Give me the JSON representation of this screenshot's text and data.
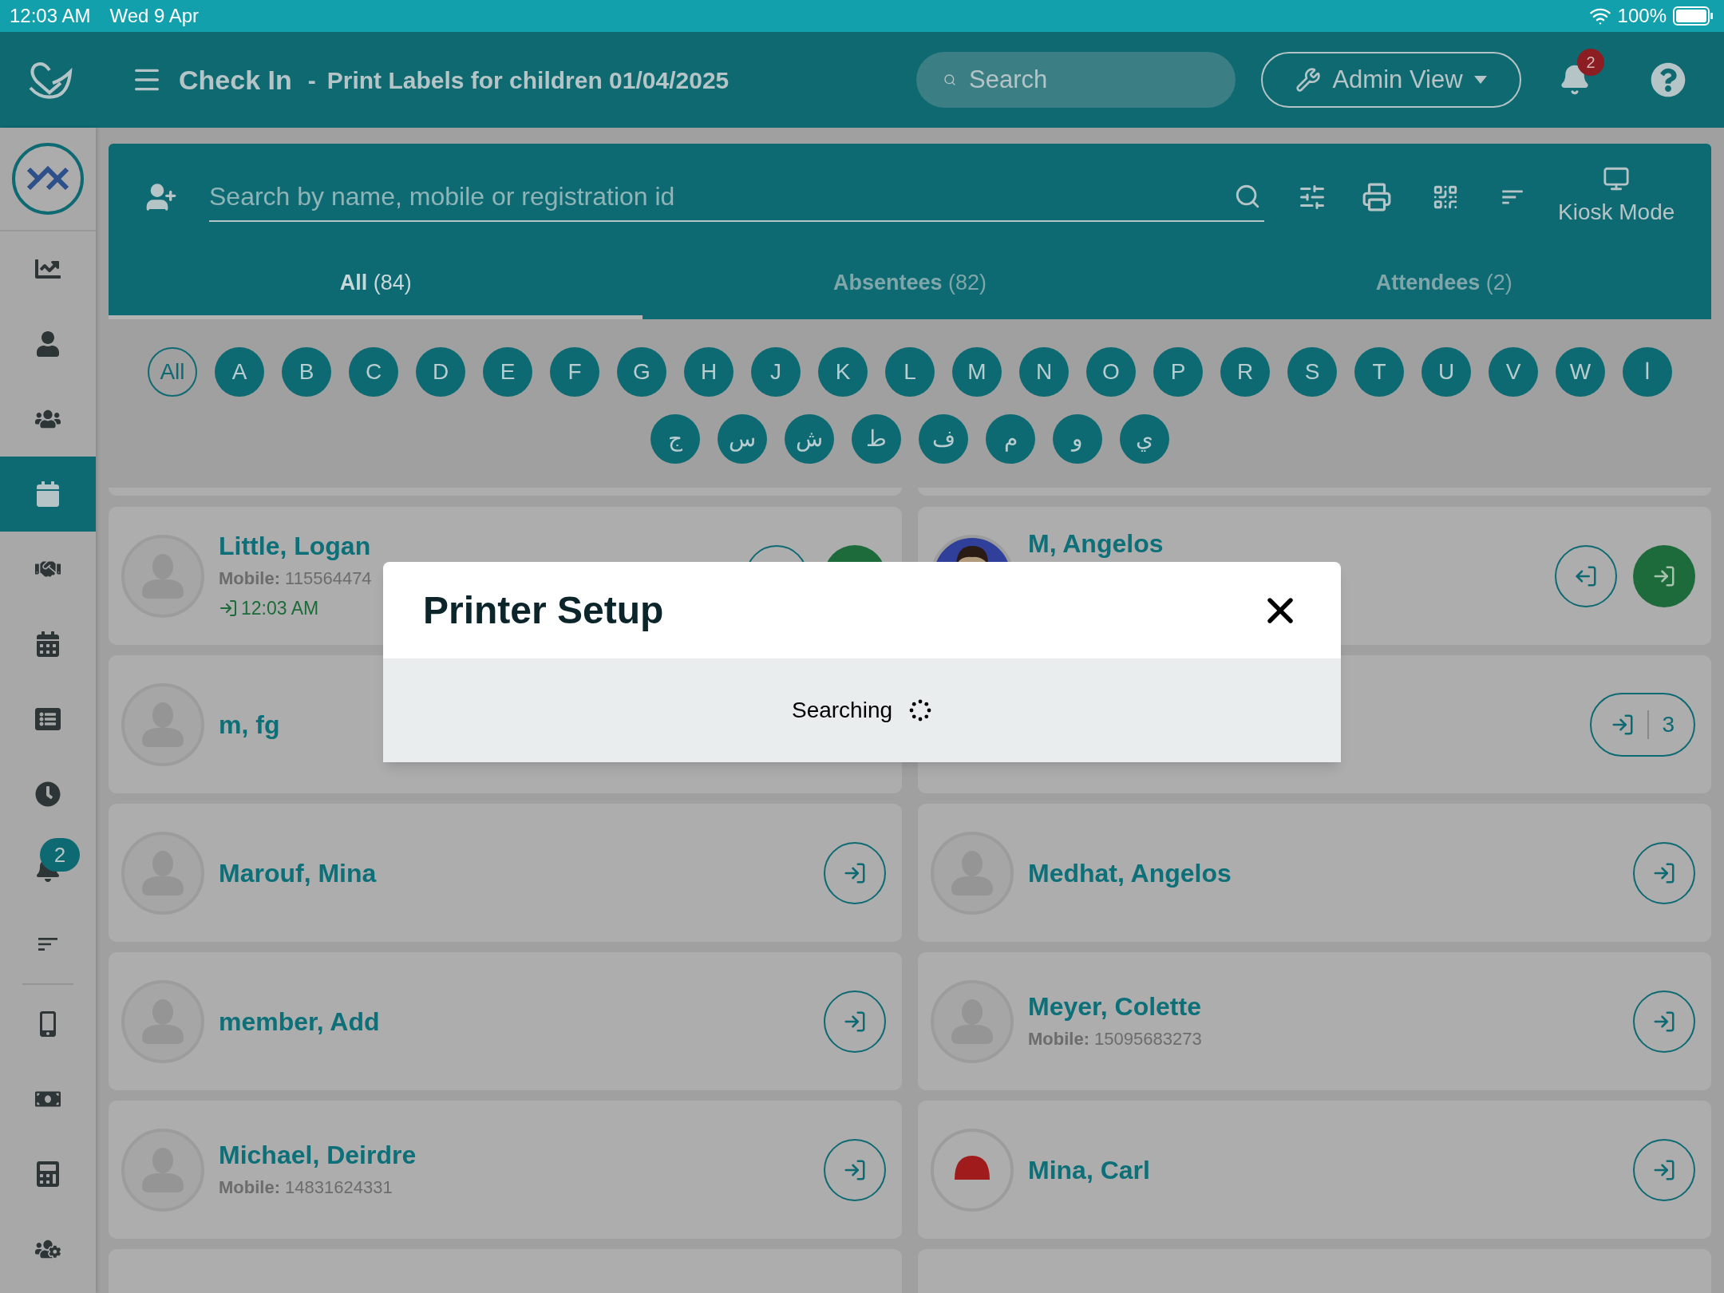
{
  "status_bar": {
    "time": "12:03 AM",
    "date": "Wed 9 Apr",
    "battery": "100%"
  },
  "header": {
    "title": "Check In",
    "separator": "-",
    "subtitle": "Print Labels for children 01/04/2025",
    "search_placeholder": "Search",
    "admin_button": "Admin View",
    "notification_badge": "2"
  },
  "sidebar": {
    "items": [
      {
        "selected": false
      },
      {
        "selected": false
      },
      {
        "selected": false
      },
      {
        "selected": true
      },
      {
        "selected": false
      },
      {
        "selected": false
      },
      {
        "selected": false
      },
      {
        "selected": false
      },
      {
        "selected": false,
        "badge": "2"
      },
      {
        "selected": false
      },
      {
        "selected": false
      },
      {
        "selected": false
      },
      {
        "selected": false
      },
      {
        "selected": false
      }
    ]
  },
  "search_panel": {
    "placeholder": "Search by name, mobile or registration id",
    "kiosk_label": "Kiosk Mode",
    "tabs": [
      {
        "label": "All",
        "count": "(84)",
        "selected": true
      },
      {
        "label": "Absentees",
        "count": "(82)",
        "selected": false
      },
      {
        "label": "Attendees",
        "count": "(2)",
        "selected": false
      }
    ]
  },
  "letters": [
    {
      "label": "All",
      "selected": true
    },
    {
      "label": "A",
      "selected": false
    },
    {
      "label": "B",
      "selected": false
    },
    {
      "label": "C",
      "selected": false
    },
    {
      "label": "D",
      "selected": false
    },
    {
      "label": "E",
      "selected": false
    },
    {
      "label": "F",
      "selected": false
    },
    {
      "label": "G",
      "selected": false
    },
    {
      "label": "H",
      "selected": false
    },
    {
      "label": "J",
      "selected": false
    },
    {
      "label": "K",
      "selected": false
    },
    {
      "label": "L",
      "selected": false
    },
    {
      "label": "M",
      "selected": false
    },
    {
      "label": "N",
      "selected": false
    },
    {
      "label": "O",
      "selected": false
    },
    {
      "label": "P",
      "selected": false
    },
    {
      "label": "R",
      "selected": false
    },
    {
      "label": "S",
      "selected": false
    },
    {
      "label": "T",
      "selected": false
    },
    {
      "label": "U",
      "selected": false
    },
    {
      "label": "V",
      "selected": false
    },
    {
      "label": "W",
      "selected": false
    },
    {
      "label": "ا",
      "selected": false
    },
    {
      "label": "ج",
      "selected": false
    },
    {
      "label": "س",
      "selected": false
    },
    {
      "label": "ش",
      "selected": false
    },
    {
      "label": "ط",
      "selected": false
    },
    {
      "label": "ف",
      "selected": false
    },
    {
      "label": "م",
      "selected": false
    },
    {
      "label": "و",
      "selected": false
    },
    {
      "label": "ي",
      "selected": false
    }
  ],
  "people": [
    {
      "name": "Little, Logan",
      "mobile": "**Mobile:** 115564474",
      "checkin_time": "12:03 AM",
      "avatar": {
        "kind": "placeholder"
      },
      "actions": {
        "kind": "checkout-checkin"
      }
    },
    {
      "name": "M, Angelos",
      "avatar": {
        "kind": "figure"
      },
      "actions": {
        "kind": "checkout-checkin"
      }
    },
    {
      "name": "m, fg",
      "avatar": {
        "kind": "placeholder"
      }
    },
    {
      "actions": {
        "kind": "checkin-count",
        "count": "3"
      }
    },
    {
      "name": "Marouf, Mina",
      "avatar": {
        "kind": "placeholder"
      },
      "actions": {
        "kind": "checkin"
      }
    },
    {
      "name": "Medhat, Angelos",
      "avatar": {
        "kind": "placeholder"
      },
      "actions": {
        "kind": "checkin"
      }
    },
    {
      "name": "member, Add",
      "avatar": {
        "kind": "placeholder"
      },
      "actions": {
        "kind": "checkin"
      }
    },
    {
      "name": "Meyer, Colette",
      "mobile": "**Mobile:** 15095683273",
      "avatar": {
        "kind": "placeholder"
      },
      "actions": {
        "kind": "checkin"
      }
    },
    {
      "name": "Michael, Deirdre",
      "mobile": "**Mobile:** 14831624331",
      "avatar": {
        "kind": "placeholder"
      },
      "actions": {
        "kind": "checkin"
      }
    },
    {
      "name": "Mina, Carl",
      "avatar": {
        "kind": "hat"
      },
      "actions": {
        "kind": "checkin"
      }
    }
  ],
  "modal": {
    "title": "Printer Setup",
    "status": "Searching"
  }
}
